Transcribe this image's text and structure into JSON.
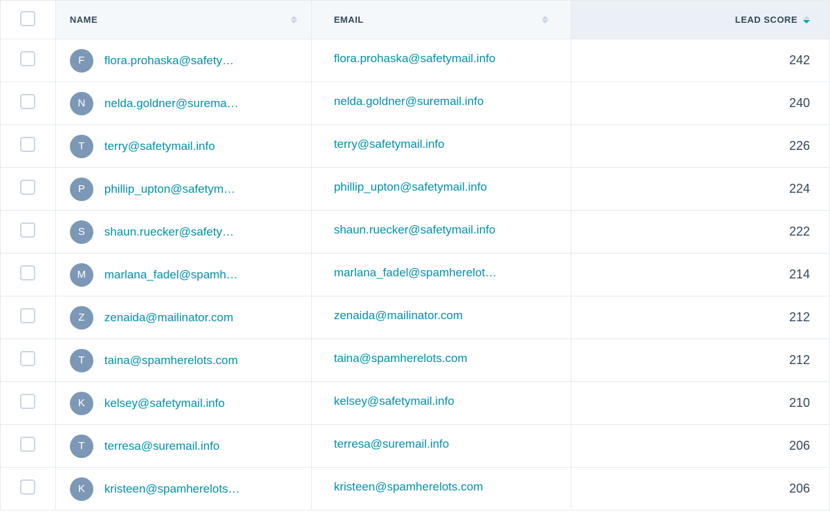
{
  "columns": {
    "name": "NAME",
    "email": "EMAIL",
    "lead_score": "LEAD SCORE",
    "sort": {
      "column": "lead_score",
      "direction": "desc"
    }
  },
  "rows": [
    {
      "avatar": "F",
      "name_display": "flora.prohaska@safety…",
      "email_display": "flora.prohaska@safetymail.info",
      "lead_score": 242
    },
    {
      "avatar": "N",
      "name_display": "nelda.goldner@surema…",
      "email_display": "nelda.goldner@suremail.info",
      "lead_score": 240
    },
    {
      "avatar": "T",
      "name_display": "terry@safetymail.info",
      "email_display": "terry@safetymail.info",
      "lead_score": 226
    },
    {
      "avatar": "P",
      "name_display": "phillip_upton@safetym…",
      "email_display": "phillip_upton@safetymail.info",
      "lead_score": 224
    },
    {
      "avatar": "S",
      "name_display": "shaun.ruecker@safety…",
      "email_display": "shaun.ruecker@safetymail.info",
      "lead_score": 222
    },
    {
      "avatar": "M",
      "name_display": "marlana_fadel@spamh…",
      "email_display": "marlana_fadel@spamherelot…",
      "lead_score": 214
    },
    {
      "avatar": "Z",
      "name_display": "zenaida@mailinator.com",
      "email_display": "zenaida@mailinator.com",
      "lead_score": 212
    },
    {
      "avatar": "T",
      "name_display": "taina@spamherelots.com",
      "email_display": "taina@spamherelots.com",
      "lead_score": 212
    },
    {
      "avatar": "K",
      "name_display": "kelsey@safetymail.info",
      "email_display": "kelsey@safetymail.info",
      "lead_score": 210
    },
    {
      "avatar": "T",
      "name_display": "terresa@suremail.info",
      "email_display": "terresa@suremail.info",
      "lead_score": 206
    },
    {
      "avatar": "K",
      "name_display": "kristeen@spamherelots…",
      "email_display": "kristeen@spamherelots.com",
      "lead_score": 206
    }
  ]
}
